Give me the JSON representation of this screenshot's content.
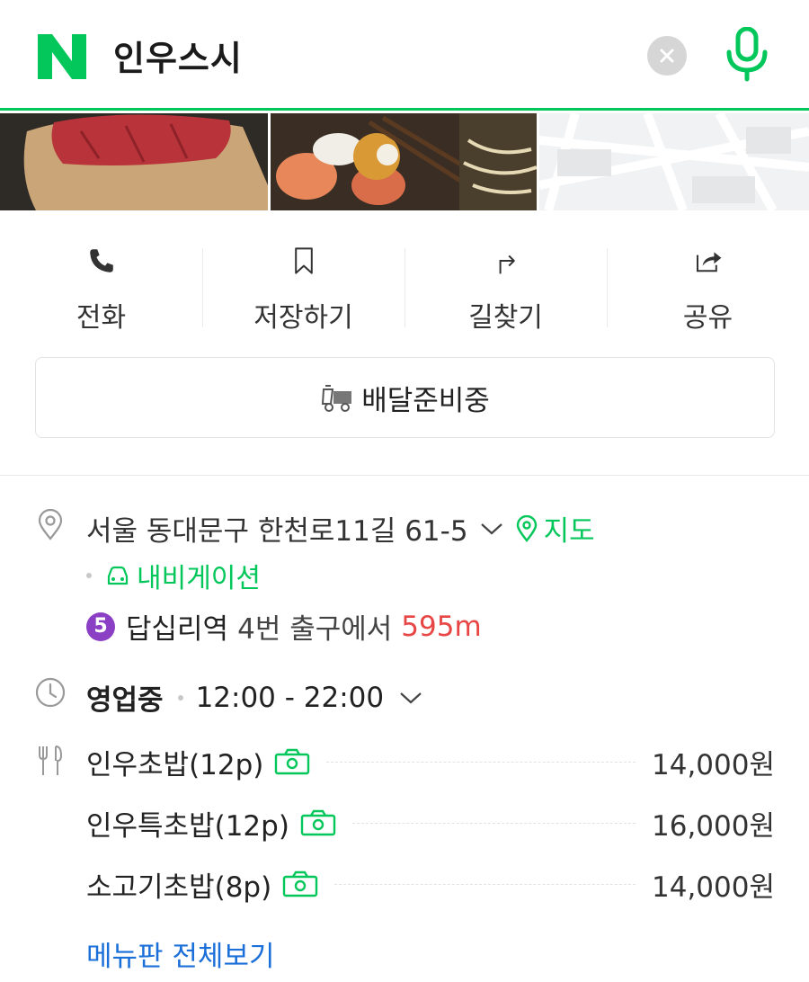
{
  "search": {
    "query": "인우스시",
    "logo_icon": "naver-n-logo",
    "clear_icon": "clear-icon",
    "mic_icon": "microphone-icon",
    "accent": "#03c75a"
  },
  "actions": [
    {
      "label": "전화",
      "icon": "phone-icon"
    },
    {
      "label": "저장하기",
      "icon": "bookmark-icon"
    },
    {
      "label": "길찾기",
      "icon": "directions-icon"
    },
    {
      "label": "공유",
      "icon": "share-icon"
    }
  ],
  "delivery": {
    "label": "배달준비중",
    "icon": "delivery-truck-icon"
  },
  "info": {
    "address": "서울 동대문구 한천로11길 61-5",
    "map_label": "지도",
    "navigation_label": "내비게이션",
    "subway": {
      "line": "5",
      "line_color": "#8b3fc4",
      "station": "답십리역",
      "exit_text": "4번 출구에서",
      "distance": "595m"
    },
    "hours": {
      "status": "영업중",
      "time": "12:00 - 22:00"
    }
  },
  "menu": {
    "items": [
      {
        "name": "인우초밥(12p)",
        "price": "14,000원"
      },
      {
        "name": "인우특초밥(12p)",
        "price": "16,000원"
      },
      {
        "name": "소고기초밥(8p)",
        "price": "14,000원"
      }
    ],
    "more_label": "메뉴판 전체보기"
  }
}
